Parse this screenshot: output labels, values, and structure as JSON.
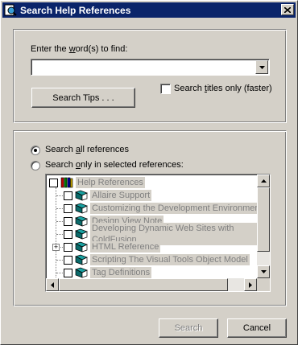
{
  "window": {
    "title": "Search Help References",
    "close_glyph": "×"
  },
  "search": {
    "prompt_pre": "Enter the ",
    "prompt_u": "w",
    "prompt_post": "ord(s) to find:",
    "value": "",
    "tips_label": "Search Tips . . .",
    "titles_only_pre": "Search ",
    "titles_only_u": "t",
    "titles_only_post": "itles only (faster)",
    "titles_only_checked": false
  },
  "scope": {
    "all_pre": "Search ",
    "all_u": "a",
    "all_post": "ll references",
    "all_selected": true,
    "selected_pre": "Search ",
    "selected_u": "o",
    "selected_post": "nly in selected references:"
  },
  "tree": {
    "root": "Help References",
    "items": [
      {
        "label": "Allaire Support",
        "expandable": false
      },
      {
        "label": "Customizing the Development Environment",
        "expandable": false
      },
      {
        "label": "Design View Note",
        "expandable": false
      },
      {
        "label": "Developing Dynamic Web Sites with ColdFusion",
        "expandable": false
      },
      {
        "label": "HTML Reference",
        "expandable": true
      },
      {
        "label": "Scripting The Visual Tools Object Model",
        "expandable": false
      },
      {
        "label": "Tag Definitions",
        "expandable": false
      }
    ]
  },
  "buttons": {
    "search": "Search",
    "cancel": "Cancel"
  },
  "colors": {
    "titlebar": "#0a246a",
    "face": "#d4d0c8"
  }
}
